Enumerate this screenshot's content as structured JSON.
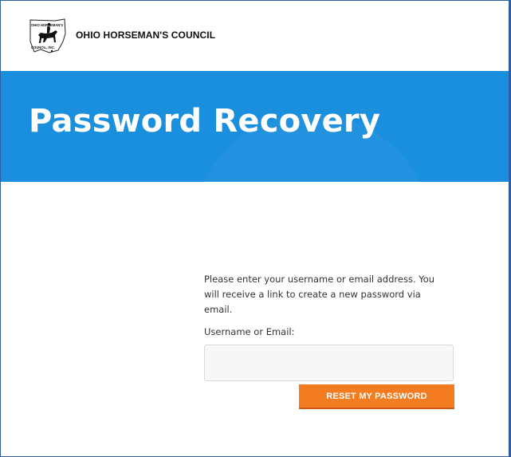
{
  "header": {
    "logo_icon": "ohio-horsemans-council-logo",
    "logo_text_top": "OHIO HORSEMAN'S",
    "logo_text_bottom": "COUNCIL, INC.",
    "site_name": "OHIO HORSEMAN'S COUNCIL"
  },
  "hero": {
    "title": "Password Recovery",
    "background_color": "#1a8fde"
  },
  "form": {
    "instructions": "Please enter your username or email address. You will receive a link to create a new password via email.",
    "field_label": "Username or Email:",
    "field_value": "",
    "submit_label": "RESET MY PASSWORD",
    "submit_color": "#f47c20"
  }
}
